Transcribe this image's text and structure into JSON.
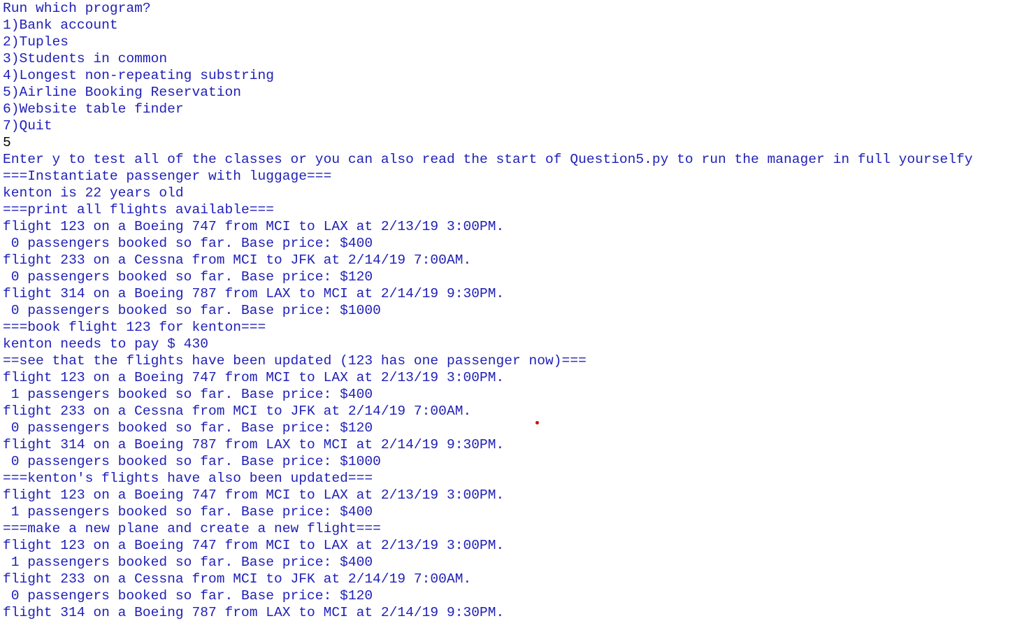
{
  "console": {
    "lines": [
      {
        "text": "Run which program?",
        "kind": "output"
      },
      {
        "text": "1)Bank account",
        "kind": "output"
      },
      {
        "text": "2)Tuples",
        "kind": "output"
      },
      {
        "text": "3)Students in common",
        "kind": "output"
      },
      {
        "text": "4)Longest non-repeating substring",
        "kind": "output"
      },
      {
        "text": "5)Airline Booking Reservation",
        "kind": "output"
      },
      {
        "text": "6)Website table finder",
        "kind": "output"
      },
      {
        "text": "7)Quit",
        "kind": "output"
      },
      {
        "text": "5",
        "kind": "input"
      },
      {
        "text": "Enter y to test all of the classes or you can also read the start of Question5.py to run the manager in full yourselfy",
        "kind": "output"
      },
      {
        "text": "===Instantiate passenger with luggage===",
        "kind": "output"
      },
      {
        "text": "kenton is 22 years old",
        "kind": "output"
      },
      {
        "text": "===print all flights available===",
        "kind": "output"
      },
      {
        "text": "flight 123 on a Boeing 747 from MCI to LAX at 2/13/19 3:00PM.",
        "kind": "output"
      },
      {
        "text": " 0 passengers booked so far. Base price: $400",
        "kind": "output"
      },
      {
        "text": "flight 233 on a Cessna from MCI to JFK at 2/14/19 7:00AM.",
        "kind": "output"
      },
      {
        "text": " 0 passengers booked so far. Base price: $120",
        "kind": "output"
      },
      {
        "text": "flight 314 on a Boeing 787 from LAX to MCI at 2/14/19 9:30PM.",
        "kind": "output"
      },
      {
        "text": " 0 passengers booked so far. Base price: $1000",
        "kind": "output"
      },
      {
        "text": "===book flight 123 for kenton===",
        "kind": "output"
      },
      {
        "text": "kenton needs to pay $ 430",
        "kind": "output"
      },
      {
        "text": "==see that the flights have been updated (123 has one passenger now)===",
        "kind": "output"
      },
      {
        "text": "flight 123 on a Boeing 747 from MCI to LAX at 2/13/19 3:00PM.",
        "kind": "output"
      },
      {
        "text": " 1 passengers booked so far. Base price: $400",
        "kind": "output"
      },
      {
        "text": "flight 233 on a Cessna from MCI to JFK at 2/14/19 7:00AM.",
        "kind": "output"
      },
      {
        "text": " 0 passengers booked so far. Base price: $120",
        "kind": "output"
      },
      {
        "text": "flight 314 on a Boeing 787 from LAX to MCI at 2/14/19 9:30PM.",
        "kind": "output"
      },
      {
        "text": " 0 passengers booked so far. Base price: $1000",
        "kind": "output"
      },
      {
        "text": "===kenton's flights have also been updated===",
        "kind": "output"
      },
      {
        "text": "flight 123 on a Boeing 747 from MCI to LAX at 2/13/19 3:00PM.",
        "kind": "output"
      },
      {
        "text": " 1 passengers booked so far. Base price: $400",
        "kind": "output"
      },
      {
        "text": "===make a new plane and create a new flight===",
        "kind": "output"
      },
      {
        "text": "flight 123 on a Boeing 747 from MCI to LAX at 2/13/19 3:00PM.",
        "kind": "output"
      },
      {
        "text": " 1 passengers booked so far. Base price: $400",
        "kind": "output"
      },
      {
        "text": "flight 233 on a Cessna from MCI to JFK at 2/14/19 7:00AM.",
        "kind": "output"
      },
      {
        "text": " 0 passengers booked so far. Base price: $120",
        "kind": "output"
      },
      {
        "text": "flight 314 on a Boeing 787 from LAX to MCI at 2/14/19 9:30PM.",
        "kind": "output"
      }
    ]
  },
  "colors": {
    "output_text": "#1f1fb8",
    "input_text": "#000000",
    "background": "#ffffff",
    "pointer_dot": "#cc1111"
  }
}
